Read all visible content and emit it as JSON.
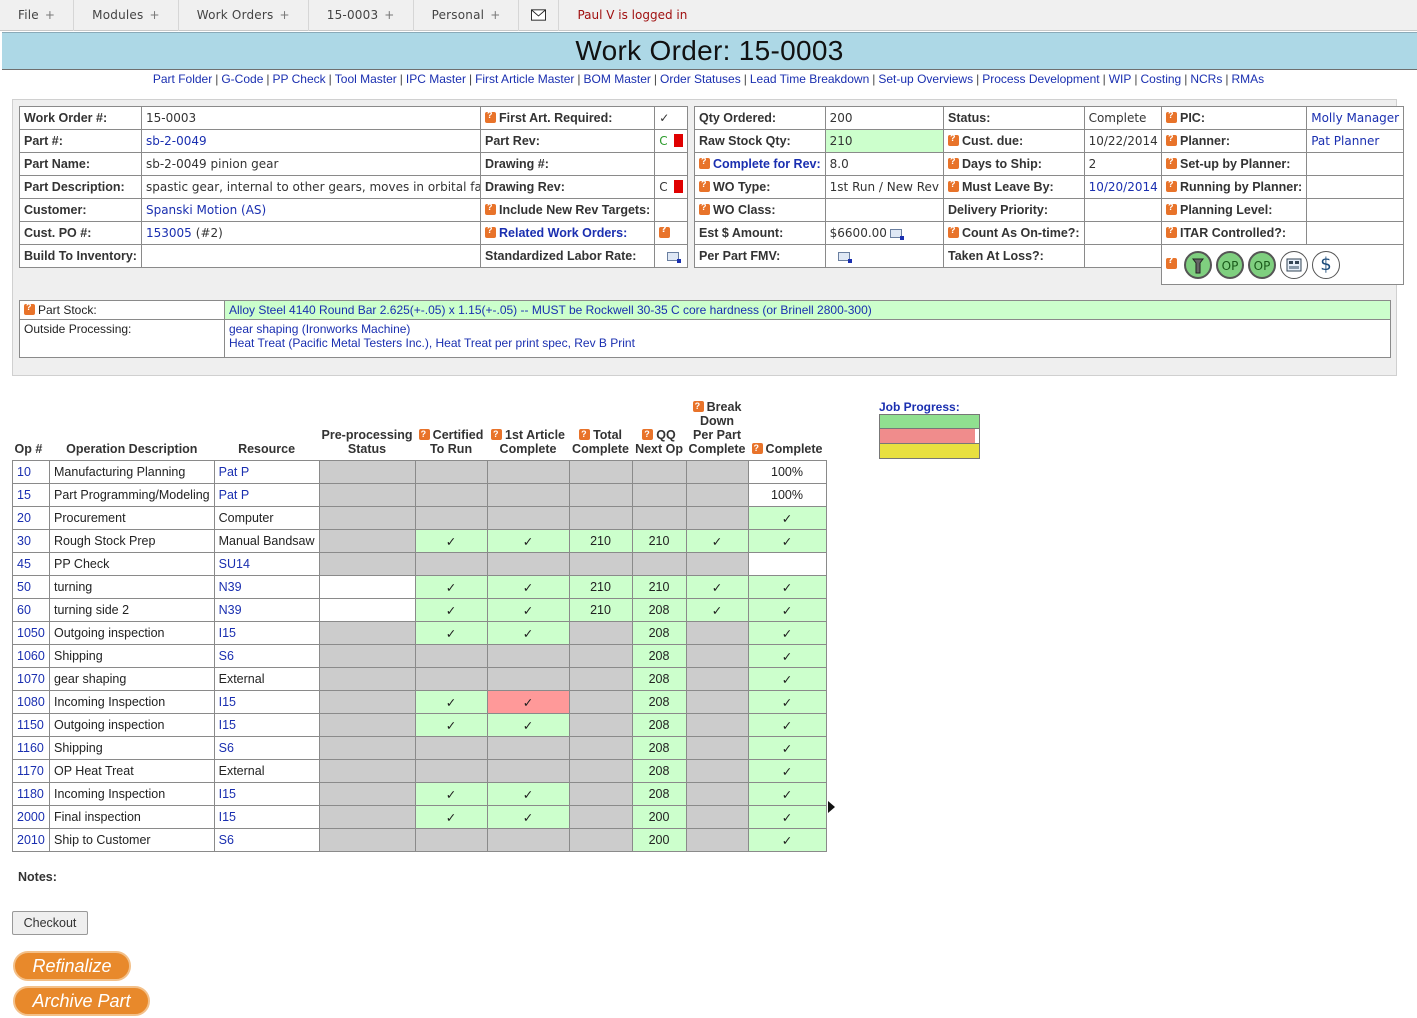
{
  "menu": {
    "items": [
      "File",
      "Modules",
      "Work Orders",
      "15-0003",
      "Personal"
    ],
    "plus": "+",
    "login": "Paul V is logged in"
  },
  "title": "Work Order: 15-0003",
  "nav_links": [
    "Part Folder",
    "G-Code",
    "PP Check",
    "Tool Master",
    "IPC Master",
    "First Article Master",
    "BOM Master",
    "Order Statuses",
    "Lead Time Breakdown",
    "Set-up Overviews",
    "Process Development",
    "WIP",
    "Costing",
    "NCRs",
    "RMAs"
  ],
  "nav_sep": "|",
  "wo": {
    "rows": [
      {
        "label": "Work Order #:",
        "value": "15-0003"
      },
      {
        "label": "Part #:",
        "value": "sb-2-0049"
      },
      {
        "label": "Part Name:",
        "value": "sb-2-0049 pinion gear"
      },
      {
        "label": "Part Description:",
        "value": "spastic gear, internal to other gears, moves in orbital fashion"
      },
      {
        "label": "Customer:",
        "value": "Spanski Motion (AS)"
      },
      {
        "label": "Cust. PO #:",
        "value": "153005",
        "value_suffix": "(#2)"
      },
      {
        "label": "Build To Inventory:",
        "value": ""
      }
    ]
  },
  "art": {
    "rows": [
      {
        "label": "First Art. Required:",
        "value": "✓"
      },
      {
        "label": "Part Rev:",
        "value": "C"
      },
      {
        "label": "Drawing #:",
        "value": ""
      },
      {
        "label": "Drawing Rev:",
        "value": "C"
      },
      {
        "label": "Include New Rev Targets:",
        "value": ""
      },
      {
        "label": "Related Work Orders:",
        "value": ""
      },
      {
        "label": "Standardized Labor Rate:",
        "value": ""
      }
    ]
  },
  "qty": {
    "rows": [
      {
        "label": "Qty Ordered:",
        "value": "200"
      },
      {
        "label": "Raw Stock Qty:",
        "value": "210"
      },
      {
        "label": "Complete for Rev:",
        "value": "8.0"
      },
      {
        "label": "WO Type:",
        "value": "1st Run / New Rev"
      },
      {
        "label": "WO Class:",
        "value": ""
      },
      {
        "label": "Est $ Amount:",
        "value": "$6600.00"
      },
      {
        "label": "Per Part FMV:",
        "value": ""
      }
    ]
  },
  "status": {
    "rows": [
      {
        "label": "Status:",
        "value": "Complete"
      },
      {
        "label": "Cust. due:",
        "value": "10/22/2014"
      },
      {
        "label": "Days to Ship:",
        "value": "2"
      },
      {
        "label": "Must Leave By:",
        "value": "10/20/2014"
      },
      {
        "label": "Delivery Priority:",
        "value": ""
      },
      {
        "label": "Count As On-time?:",
        "value": ""
      },
      {
        "label": "Taken At Loss?:",
        "value": ""
      }
    ]
  },
  "pic": {
    "rows": [
      {
        "label": "PIC:",
        "value": "Molly Manager"
      },
      {
        "label": "Planner:",
        "value": "Pat Planner"
      },
      {
        "label": "Set-up by Planner:",
        "value": ""
      },
      {
        "label": "Running by Planner:",
        "value": ""
      },
      {
        "label": "Planning Level:",
        "value": ""
      },
      {
        "label": "ITAR Controlled?:",
        "value": ""
      }
    ],
    "buttons": [
      "OP",
      "OP",
      "$"
    ]
  },
  "stock": {
    "part_stock_label": "Part Stock:",
    "part_stock_value": "Alloy Steel 4140 Round Bar 2.625(+-.05) x 1.15(+-.05) -- MUST be Rockwell 30-35 C core hardness (or Brinell 2800-300)",
    "outside_label": "Outside Processing:",
    "outside_line1": "gear shaping (Ironworks Machine)",
    "outside_line2": "Heat Treat (Pacific Metal Testers Inc.), Heat Treat per print spec, Rev B Print"
  },
  "ops": {
    "headers": {
      "op": "Op #",
      "desc": "Operation Description",
      "resource": "Resource",
      "pre1": "Pre-processing",
      "pre2": "Status",
      "cert1": "Certified",
      "cert2": "To Run",
      "fa1": "1st Article",
      "fa2": "Complete",
      "tot1": "Total",
      "tot2": "Complete",
      "qq1": "QQ",
      "qq2": "Next Op",
      "bd1": "Break",
      "bd2": "Down",
      "bd3": "Per Part",
      "bd4": "Complete",
      "comp": "Complete"
    },
    "rows": [
      {
        "op": "10",
        "desc": "Manufacturing Planning",
        "res": "Pat P",
        "res_link": true,
        "pre": "g",
        "cert": [
          "g",
          ""
        ],
        "fa": [
          "g",
          ""
        ],
        "tot": [
          "g",
          ""
        ],
        "qq": [
          "g",
          ""
        ],
        "bd": [
          "g",
          ""
        ],
        "comp": [
          "w",
          "100%"
        ]
      },
      {
        "op": "15",
        "desc": "Part Programming/Modeling",
        "res": "Pat P",
        "res_link": true,
        "pre": "g",
        "cert": [
          "g",
          ""
        ],
        "fa": [
          "g",
          ""
        ],
        "tot": [
          "g",
          ""
        ],
        "qq": [
          "g",
          ""
        ],
        "bd": [
          "g",
          ""
        ],
        "comp": [
          "w",
          "100%"
        ]
      },
      {
        "op": "20",
        "desc": "Procurement",
        "res": "Computer",
        "res_link": false,
        "pre": "g",
        "cert": [
          "g",
          ""
        ],
        "fa": [
          "g",
          ""
        ],
        "tot": [
          "g",
          ""
        ],
        "qq": [
          "g",
          ""
        ],
        "bd": [
          "g",
          ""
        ],
        "comp": [
          "gr",
          "✓"
        ]
      },
      {
        "op": "30",
        "desc": "Rough Stock Prep",
        "res": "Manual Bandsaw",
        "res_link": false,
        "pre": "g",
        "cert": [
          "gr",
          "✓"
        ],
        "fa": [
          "gr",
          "✓"
        ],
        "tot": [
          "gr",
          "210"
        ],
        "qq": [
          "gr",
          "210"
        ],
        "bd": [
          "gr",
          "✓"
        ],
        "comp": [
          "gr",
          "✓"
        ]
      },
      {
        "op": "45",
        "desc": "PP Check",
        "res": "SU14",
        "res_link": true,
        "pre": "g",
        "cert": [
          "g",
          ""
        ],
        "fa": [
          "g",
          ""
        ],
        "tot": [
          "g",
          ""
        ],
        "qq": [
          "g",
          ""
        ],
        "bd": [
          "g",
          ""
        ],
        "comp": [
          "w",
          ""
        ]
      },
      {
        "op": "50",
        "desc": "turning",
        "res": "N39",
        "res_link": true,
        "pre": "w",
        "cert": [
          "gr",
          "✓"
        ],
        "fa": [
          "gr",
          "✓"
        ],
        "tot": [
          "gr",
          "210"
        ],
        "qq": [
          "gr",
          "210"
        ],
        "bd": [
          "gr",
          "✓"
        ],
        "comp": [
          "gr",
          "✓"
        ]
      },
      {
        "op": "60",
        "desc": "turning side 2",
        "res": "N39",
        "res_link": true,
        "pre": "w",
        "cert": [
          "gr",
          "✓"
        ],
        "fa": [
          "gr",
          "✓"
        ],
        "tot": [
          "gr",
          "210"
        ],
        "qq": [
          "gr",
          "208"
        ],
        "bd": [
          "gr",
          "✓"
        ],
        "comp": [
          "gr",
          "✓"
        ]
      },
      {
        "op": "1050",
        "desc": "Outgoing inspection",
        "res": "I15",
        "res_link": true,
        "pre": "g",
        "cert": [
          "gr",
          "✓"
        ],
        "fa": [
          "gr",
          "✓"
        ],
        "tot": [
          "g",
          ""
        ],
        "qq": [
          "gr",
          "208"
        ],
        "bd": [
          "g",
          ""
        ],
        "comp": [
          "gr",
          "✓"
        ]
      },
      {
        "op": "1060",
        "desc": "Shipping",
        "res": "S6",
        "res_link": true,
        "pre": "g",
        "cert": [
          "g",
          ""
        ],
        "fa": [
          "g",
          ""
        ],
        "tot": [
          "g",
          ""
        ],
        "qq": [
          "gr",
          "208"
        ],
        "bd": [
          "g",
          ""
        ],
        "comp": [
          "gr",
          "✓"
        ]
      },
      {
        "op": "1070",
        "desc": "gear shaping",
        "res": "External",
        "res_link": false,
        "pre": "g",
        "cert": [
          "g",
          ""
        ],
        "fa": [
          "g",
          ""
        ],
        "tot": [
          "g",
          ""
        ],
        "qq": [
          "gr",
          "208"
        ],
        "bd": [
          "g",
          ""
        ],
        "comp": [
          "gr",
          "✓"
        ]
      },
      {
        "op": "1080",
        "desc": "Incoming Inspection",
        "res": "I15",
        "res_link": true,
        "pre": "g",
        "cert": [
          "gr",
          "✓"
        ],
        "fa": [
          "rd",
          "✓"
        ],
        "tot": [
          "g",
          ""
        ],
        "qq": [
          "gr",
          "208"
        ],
        "bd": [
          "g",
          ""
        ],
        "comp": [
          "gr",
          "✓"
        ]
      },
      {
        "op": "1150",
        "desc": "Outgoing inspection",
        "res": "I15",
        "res_link": true,
        "pre": "g",
        "cert": [
          "gr",
          "✓"
        ],
        "fa": [
          "gr",
          "✓"
        ],
        "tot": [
          "g",
          ""
        ],
        "qq": [
          "gr",
          "208"
        ],
        "bd": [
          "g",
          ""
        ],
        "comp": [
          "gr",
          "✓"
        ]
      },
      {
        "op": "1160",
        "desc": "Shipping",
        "res": "S6",
        "res_link": true,
        "pre": "g",
        "cert": [
          "g",
          ""
        ],
        "fa": [
          "g",
          ""
        ],
        "tot": [
          "g",
          ""
        ],
        "qq": [
          "gr",
          "208"
        ],
        "bd": [
          "g",
          ""
        ],
        "comp": [
          "gr",
          "✓"
        ]
      },
      {
        "op": "1170",
        "desc": "OP Heat Treat",
        "res": "External",
        "res_link": false,
        "pre": "g",
        "cert": [
          "g",
          ""
        ],
        "fa": [
          "g",
          ""
        ],
        "tot": [
          "g",
          ""
        ],
        "qq": [
          "gr",
          "208"
        ],
        "bd": [
          "g",
          ""
        ],
        "comp": [
          "gr",
          "✓"
        ]
      },
      {
        "op": "1180",
        "desc": "Incoming Inspection",
        "res": "I15",
        "res_link": true,
        "pre": "g",
        "cert": [
          "gr",
          "✓"
        ],
        "fa": [
          "gr",
          "✓"
        ],
        "tot": [
          "g",
          ""
        ],
        "qq": [
          "gr",
          "208"
        ],
        "bd": [
          "g",
          ""
        ],
        "comp": [
          "gr",
          "✓"
        ]
      },
      {
        "op": "2000",
        "desc": "Final inspection",
        "res": "I15",
        "res_link": true,
        "pre": "g",
        "cert": [
          "gr",
          "✓"
        ],
        "fa": [
          "gr",
          "✓"
        ],
        "tot": [
          "g",
          ""
        ],
        "qq": [
          "gr",
          "200"
        ],
        "bd": [
          "g",
          ""
        ],
        "comp": [
          "gr",
          "✓"
        ]
      },
      {
        "op": "2010",
        "desc": "Ship to Customer",
        "res": "S6",
        "res_link": true,
        "pre": "g",
        "cert": [
          "g",
          ""
        ],
        "fa": [
          "g",
          ""
        ],
        "tot": [
          "g",
          ""
        ],
        "qq": [
          "gr",
          "200"
        ],
        "bd": [
          "g",
          ""
        ],
        "comp": [
          "gr",
          "✓"
        ]
      }
    ]
  },
  "job_progress": {
    "label": "Job Progress:",
    "bars": [
      {
        "color": "#90e090",
        "fraction": 1.0
      },
      {
        "color": "#f08c8c",
        "fraction": 0.96
      },
      {
        "color": "#e8e040",
        "fraction": 1.0
      }
    ]
  },
  "notes_label": "Notes:",
  "checkout_label": "Checkout",
  "refinalize_label": "Refinalize",
  "archive_label": "Archive Part",
  "colors": {
    "link": "#1a2fb0",
    "title_bg": "#add8e6",
    "green_cell": "#ccffcc",
    "gray_cell": "#cccccc",
    "red_cell": "#ff9999",
    "orange_btn": "#e8892b"
  }
}
